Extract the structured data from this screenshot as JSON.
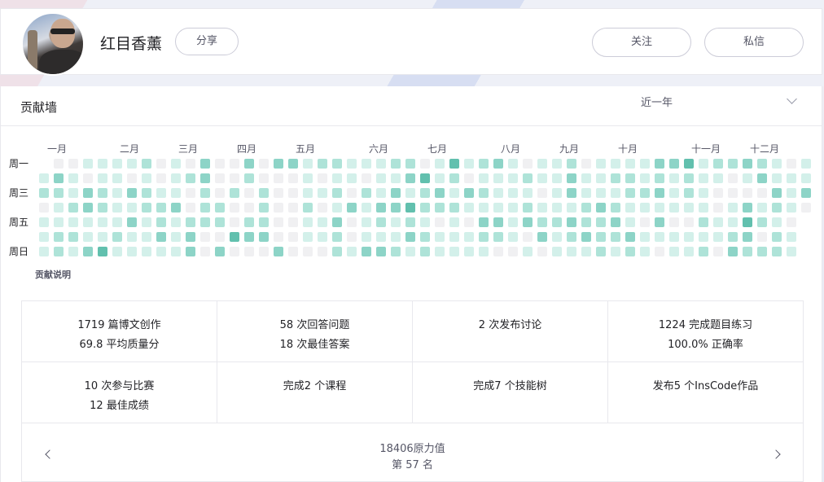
{
  "profile": {
    "username": "红目香薰",
    "share_label": "分享",
    "follow_label": "关注",
    "message_label": "私信"
  },
  "contrib": {
    "title": "贡献墙",
    "range": "近一年",
    "explain": "贡献说明",
    "months": [
      "一月",
      "二月",
      "三月",
      "四月",
      "五月",
      "六月",
      "七月",
      "八月",
      "九月",
      "十月",
      "十一月",
      "十二月"
    ],
    "weekdays": [
      "周一",
      "周三",
      "周五",
      "周日"
    ]
  },
  "colors": {
    "level0": "#f0f0f2",
    "level1": "#d3f0ea",
    "level2": "#aee3d8",
    "level3": "#8dd4c7",
    "level4": "#62c0ae"
  },
  "stats": {
    "items": [
      {
        "line1": "1719 篇博文创作",
        "line2": "69.8 平均质量分"
      },
      {
        "line1": "58 次回答问题",
        "line2": "18 次最佳答案"
      },
      {
        "line1": "2 次发布讨论",
        "line2": ""
      },
      {
        "line1": "1224 完成题目练习",
        "line2": "100.0% 正确率"
      },
      {
        "line1": "10 次参与比赛",
        "line2": "12 最佳成绩"
      },
      {
        "line1": "完成2 个课程",
        "line2": ""
      },
      {
        "line1": "完成7 个技能树",
        "line2": ""
      },
      {
        "line1": "发布5 个InsCode作品",
        "line2": ""
      }
    ],
    "power_value": "18406原力值",
    "rank": "第 57 名"
  }
}
